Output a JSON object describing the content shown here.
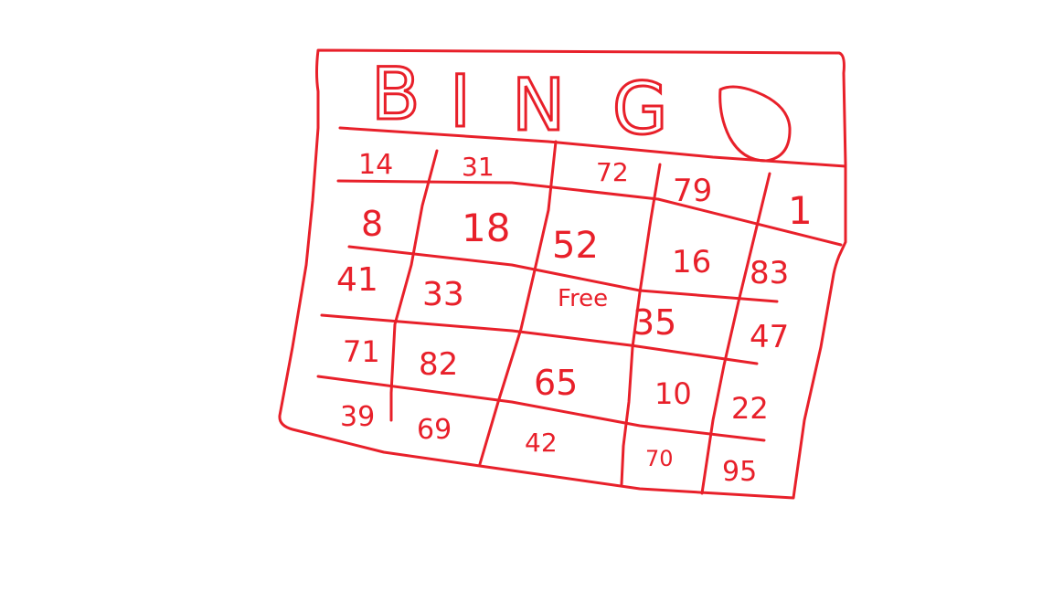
{
  "card": {
    "title": "BINGO",
    "ink_color": "#e8202a",
    "background_color": "#ffffff",
    "title_letters": [
      "B",
      "I",
      "N",
      "G",
      "O"
    ],
    "cells": [
      [
        "14",
        "31",
        "72",
        "79",
        "1"
      ],
      [
        "8",
        "18",
        "52",
        "16",
        "83"
      ],
      [
        "41",
        "33",
        "Free",
        "35",
        "47"
      ],
      [
        "71",
        "82",
        "65",
        "10",
        "22"
      ],
      [
        "39",
        "69",
        "42",
        "70",
        "95"
      ]
    ]
  }
}
